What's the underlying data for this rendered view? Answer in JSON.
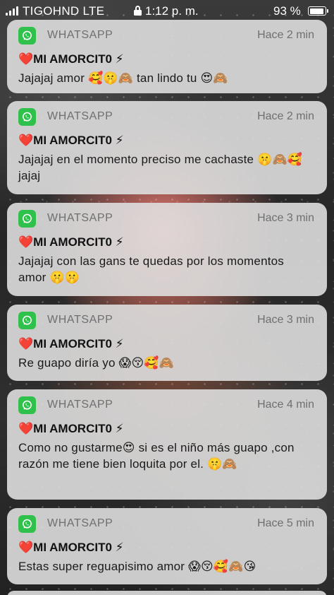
{
  "status_bar": {
    "carrier": "TIGOHND  LTE",
    "time": "1:12 p. m.",
    "battery": "93 %",
    "battery_level": 0.93
  },
  "notifications": [
    {
      "app": "WHATSAPP",
      "time_ago": "Hace 2 min",
      "sender": "❤️MI AMORCIT0 ⚡",
      "message": "Jajajaj amor 🥰🤫🙈 tan lindo tu 😍🙈"
    },
    {
      "app": "WHATSAPP",
      "time_ago": "Hace 2 min",
      "sender": "❤️MI AMORCIT0 ⚡",
      "message": "Jajajaj en el momento preciso me cachaste 🤫🙈🥰jajaj"
    },
    {
      "app": "WHATSAPP",
      "time_ago": "Hace 3 min",
      "sender": "❤️MI AMORCIT0 ⚡",
      "message": "Jajajaj con las gans te quedas por los momentos amor 🤫🤫"
    },
    {
      "app": "WHATSAPP",
      "time_ago": "Hace 3 min",
      "sender": "❤️MI AMORCIT0 ⚡",
      "message": "Re guapo diría yo 😱😚🥰🙈"
    },
    {
      "app": "WHATSAPP",
      "time_ago": "Hace 4 min",
      "sender": "❤️MI AMORCIT0 ⚡",
      "message": "Como no gustarme😍 si es el niño más guapo ,con razón me tiene bien loquita por el. 🤫🙈"
    },
    {
      "app": "WHATSAPP",
      "time_ago": "Hace 5 min",
      "sender": "❤️MI AMORCIT0 ⚡",
      "message": "Estas super reguapisimo amor 😱😚🥰🙈😘"
    }
  ],
  "colors": {
    "whatsapp_green": "#30c14c",
    "card_background": "#dedede",
    "secondary_text": "#6f6f6f"
  }
}
